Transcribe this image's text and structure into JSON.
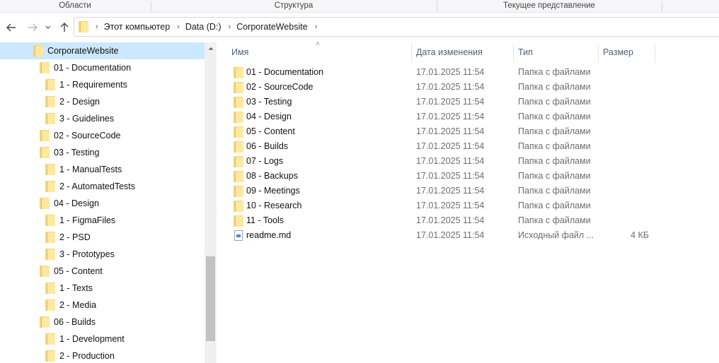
{
  "ribbon": {
    "groups": [
      "Области",
      "Структура",
      "Текущее представление"
    ]
  },
  "nav": {
    "back_icon": "arrow-left-icon",
    "forward_icon": "arrow-right-icon",
    "recent_icon": "chevron-down-icon",
    "up_icon": "arrow-up-icon"
  },
  "address": {
    "crumbs": [
      "Этот компьютер",
      "Data (D:)",
      "CorporateWebsite"
    ]
  },
  "tree": {
    "items": [
      {
        "label": "CorporateWebsite",
        "level": 0,
        "selected": true
      },
      {
        "label": "01 - Documentation",
        "level": 1
      },
      {
        "label": "1 - Requirements",
        "level": 2
      },
      {
        "label": "2 - Design",
        "level": 2
      },
      {
        "label": "3 - Guidelines",
        "level": 2
      },
      {
        "label": "02 - SourceCode",
        "level": 1
      },
      {
        "label": "03 - Testing",
        "level": 1
      },
      {
        "label": "1 - ManualTests",
        "level": 2
      },
      {
        "label": "2 - AutomatedTests",
        "level": 2
      },
      {
        "label": "04 - Design",
        "level": 1
      },
      {
        "label": "1 - FigmaFiles",
        "level": 2
      },
      {
        "label": "2 - PSD",
        "level": 2
      },
      {
        "label": "3 - Prototypes",
        "level": 2
      },
      {
        "label": "05 - Content",
        "level": 1
      },
      {
        "label": "1 - Texts",
        "level": 2
      },
      {
        "label": "2 - Media",
        "level": 2
      },
      {
        "label": "06 - Builds",
        "level": 1
      },
      {
        "label": "1 - Development",
        "level": 2
      },
      {
        "label": "2 - Production",
        "level": 2
      }
    ]
  },
  "columns": {
    "name": "Имя",
    "date": "Дата изменения",
    "type": "Тип",
    "size": "Размер"
  },
  "files": [
    {
      "name": "01 - Documentation",
      "date": "17.01.2025 11:54",
      "type": "Папка с файлами",
      "size": "",
      "icon": "folder-icon"
    },
    {
      "name": "02 - SourceCode",
      "date": "17.01.2025 11:54",
      "type": "Папка с файлами",
      "size": "",
      "icon": "folder-icon"
    },
    {
      "name": "03 - Testing",
      "date": "17.01.2025 11:54",
      "type": "Папка с файлами",
      "size": "",
      "icon": "folder-icon"
    },
    {
      "name": "04 - Design",
      "date": "17.01.2025 11:54",
      "type": "Папка с файлами",
      "size": "",
      "icon": "folder-icon"
    },
    {
      "name": "05 - Content",
      "date": "17.01.2025 11:54",
      "type": "Папка с файлами",
      "size": "",
      "icon": "folder-icon"
    },
    {
      "name": "06 - Builds",
      "date": "17.01.2025 11:54",
      "type": "Папка с файлами",
      "size": "",
      "icon": "folder-icon"
    },
    {
      "name": "07 - Logs",
      "date": "17.01.2025 11:54",
      "type": "Папка с файлами",
      "size": "",
      "icon": "folder-icon"
    },
    {
      "name": "08 - Backups",
      "date": "17.01.2025 11:54",
      "type": "Папка с файлами",
      "size": "",
      "icon": "folder-icon"
    },
    {
      "name": "09 - Meetings",
      "date": "17.01.2025 11:54",
      "type": "Папка с файлами",
      "size": "",
      "icon": "folder-icon"
    },
    {
      "name": "10 - Research",
      "date": "17.01.2025 11:54",
      "type": "Папка с файлами",
      "size": "",
      "icon": "folder-icon"
    },
    {
      "name": "11 - Tools",
      "date": "17.01.2025 11:54",
      "type": "Папка с файлами",
      "size": "",
      "icon": "folder-icon"
    },
    {
      "name": "readme.md",
      "date": "17.01.2025 11:54",
      "type": "Исходный файл ...",
      "size": "4 КБ",
      "icon": "document-icon"
    }
  ],
  "colors": {
    "selection": "#cce8ff",
    "header_text": "#4c607a",
    "folder": "#ffe8a0"
  }
}
